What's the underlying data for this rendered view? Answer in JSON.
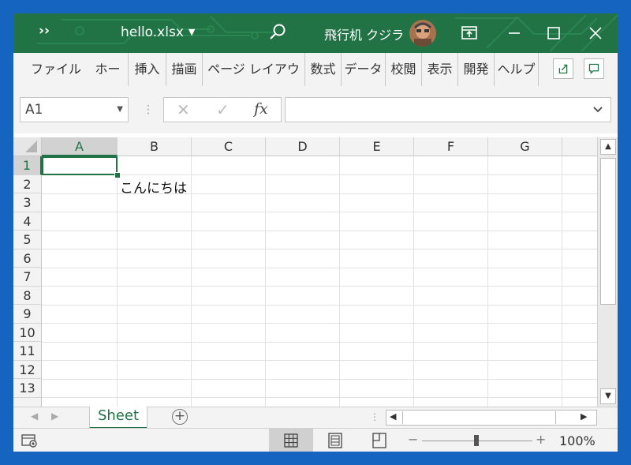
{
  "window": {
    "file_name": "hello.xlsx",
    "user_name": "飛行机 クジラ",
    "colors": {
      "title_bar": "#217346",
      "desktop": "#1565c0",
      "accent": "#217346"
    }
  },
  "icons": {
    "overflow": "chevron-double-right-icon",
    "search": "search-icon",
    "ribbon_display": "ribbon-display-icon",
    "minimize": "minimize-icon",
    "maximize": "maximize-icon",
    "close": "close-icon",
    "share": "share-icon",
    "comments": "comment-icon"
  },
  "ribbon": {
    "tabs": [
      "ファイル",
      "ホーム",
      "挿入",
      "描画",
      "ページ レイアウト",
      "数式",
      "データ",
      "校閲",
      "表示",
      "開発",
      "ヘルプ"
    ]
  },
  "formula_bar": {
    "name_box": "A1",
    "cancel_glyph": "✕",
    "enter_glyph": "✓",
    "function_glyph": "fx",
    "formula_value": ""
  },
  "grid": {
    "columns": [
      "A",
      "B",
      "C",
      "D",
      "E",
      "F",
      "G"
    ],
    "rows": [
      "1",
      "2",
      "3",
      "4",
      "5",
      "6",
      "7",
      "8",
      "9",
      "10",
      "11",
      "12",
      "13"
    ],
    "selected_cell": "A1",
    "cells": [
      {
        "ref": "B2",
        "value": "こんにちは"
      }
    ]
  },
  "sheets": {
    "tabs": [
      "Sheet"
    ],
    "active": "Sheet",
    "add_glyph": "+"
  },
  "status": {
    "zoom_label": "100%",
    "zoom_minus": "−",
    "zoom_plus": "+"
  }
}
